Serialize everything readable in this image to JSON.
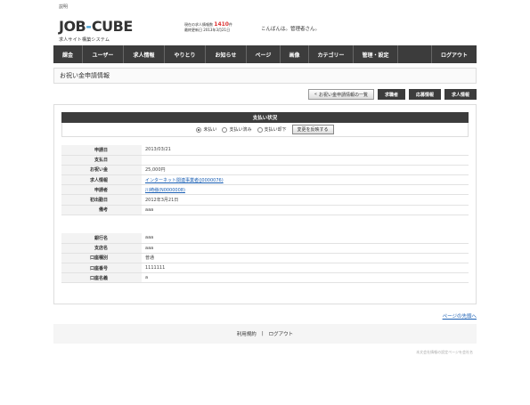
{
  "top_note": "説明",
  "logo": {
    "job": "JOB",
    "dash": "-",
    "cube": "CUBE",
    "subtitle": "求人サイト構築システム"
  },
  "stats": {
    "line1_prefix": "現在の求人情報数",
    "count": "1410",
    "line1_suffix": "件",
    "line2": "最終更新日 2013年3月21日"
  },
  "greeting": "こんばんは。管理者さん。",
  "nav": [
    "課金",
    "ユーザー",
    "求人情報",
    "やりとり",
    "お知らせ",
    "ページ",
    "画像",
    "カテゴリー",
    "管理・設定",
    "",
    "ログアウト"
  ],
  "page_title": "お祝い金申請情報",
  "buttons": {
    "back": "お祝い金申請情報の一覧",
    "b1": "求職者",
    "b2": "応募情報",
    "b3": "求人情報"
  },
  "status": {
    "header": "支払い状況",
    "options": [
      "未払い",
      "支払い済み",
      "支払い却下"
    ],
    "selected": 0,
    "apply": "変更を反映する"
  },
  "details": [
    {
      "label": "申請日",
      "value": "2013/03/21"
    },
    {
      "label": "支払日",
      "value": ""
    },
    {
      "label": "お祝い金",
      "value": "25,000円"
    },
    {
      "label": "求人情報",
      "value": "インターネット関連事業者(J0000076)",
      "link": true
    },
    {
      "label": "申請者",
      "value": "川崎様(N0000008)",
      "link": true
    },
    {
      "label": "初出勤日",
      "value": "2012年3月21日"
    },
    {
      "label": "備考",
      "value": "aaa"
    }
  ],
  "bank": [
    {
      "label": "銀行名",
      "value": "aaa"
    },
    {
      "label": "支店名",
      "value": "aaa"
    },
    {
      "label": "口座種別",
      "value": "普通"
    },
    {
      "label": "口座番号",
      "value": "1111111"
    },
    {
      "label": "口座名義",
      "value": "a"
    }
  ],
  "pagetop": "ページの先頭へ",
  "footer": {
    "terms": "利用規約",
    "sep": "|",
    "logout": "ログアウト"
  },
  "copyright": "本文会社情報の設定ページを会社名"
}
